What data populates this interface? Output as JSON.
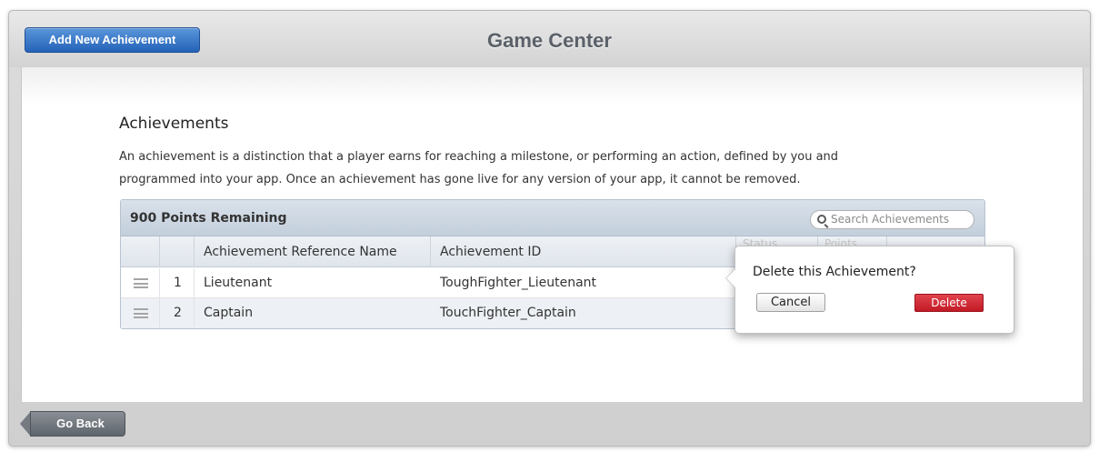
{
  "header": {
    "add_button_label": "Add New Achievement",
    "title": "Game Center"
  },
  "section": {
    "title": "Achievements",
    "description_line1": "An achievement is a distinction that a player earns for reaching a milestone, or performing an action, defined by you and",
    "description_line2": "programmed into your app. Once an achievement has gone live for any version of your app, it cannot be removed."
  },
  "table": {
    "points_remaining": "900 Points Remaining",
    "search_placeholder": "Search Achievements",
    "columns": {
      "reference_name": "Achievement Reference Name",
      "achievement_id": "Achievement ID",
      "status": "Status",
      "points": "Points"
    },
    "rows": [
      {
        "index": "1",
        "reference_name": "Lieutenant",
        "achievement_id": "ToughFighter_Lieutenant"
      },
      {
        "index": "2",
        "reference_name": "Captain",
        "achievement_id": "TouchFighter_Captain"
      }
    ]
  },
  "popover": {
    "title": "Delete this Achievement?",
    "cancel_label": "Cancel",
    "delete_label": "Delete"
  },
  "footer": {
    "back_label": "Go Back"
  },
  "colors": {
    "primary_button": "#2462b8",
    "delete_button": "#c21a26",
    "back_button": "#5f656c"
  }
}
